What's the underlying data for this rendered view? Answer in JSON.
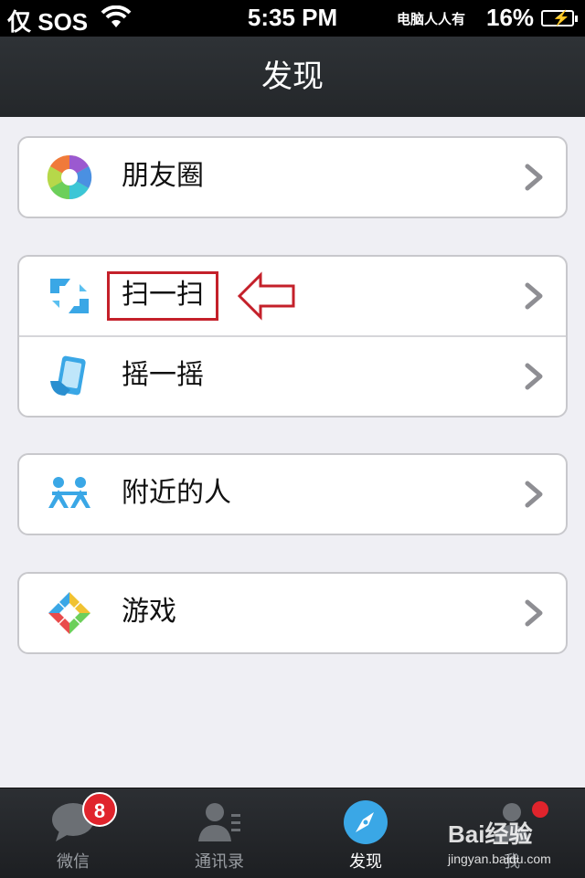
{
  "status_bar": {
    "carrier": "仅 SOS",
    "time": "5:35 PM",
    "watermark": "电脑人人有",
    "battery": "16%"
  },
  "nav": {
    "title": "发现"
  },
  "groups": [
    {
      "items": [
        {
          "label": "朋友圈",
          "icon": "moments-aperture-icon"
        }
      ]
    },
    {
      "items": [
        {
          "label": "扫一扫",
          "icon": "scan-icon",
          "highlighted": true
        },
        {
          "label": "摇一摇",
          "icon": "shake-phone-icon"
        }
      ]
    },
    {
      "items": [
        {
          "label": "附近的人",
          "icon": "people-nearby-icon"
        }
      ]
    },
    {
      "items": [
        {
          "label": "游戏",
          "icon": "games-icon"
        }
      ]
    }
  ],
  "tabs": [
    {
      "label": "微信",
      "icon": "chat-bubble-icon",
      "badge": "8"
    },
    {
      "label": "通讯录",
      "icon": "contacts-icon"
    },
    {
      "label": "发现",
      "icon": "compass-icon",
      "active": true
    },
    {
      "label": "我",
      "icon": "person-icon",
      "dot": true
    }
  ],
  "watermark_baidu": {
    "logo": "Bai经验",
    "url": "jingyan.baidu.com"
  },
  "colors": {
    "accent": "#3aa7e6",
    "annotation_red": "#c4202a",
    "badge": "#e0242c"
  }
}
